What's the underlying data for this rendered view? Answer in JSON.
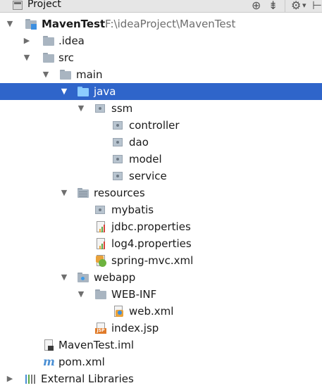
{
  "header": {
    "title": "Project",
    "locate_icon": "⊕",
    "collapse_icon": "⇟",
    "settings_icon": "⚙",
    "settings_arrow": "▾",
    "hide_icon": "⊢"
  },
  "tree": {
    "project_name": "MavenTest",
    "project_path": "F:\\ideaProject\\MavenTest",
    "idea": ".idea",
    "src": "src",
    "main": "main",
    "java": "java",
    "ssm": "ssm",
    "controller": "controller",
    "dao": "dao",
    "model": "model",
    "service": "service",
    "resources": "resources",
    "mybatis": "mybatis",
    "jdbc": "jdbc.properties",
    "log4j": "log4.properties",
    "spring_mvc": "spring-mvc.xml",
    "webapp": "webapp",
    "web_inf": "WEB-INF",
    "web_xml": "web.xml",
    "index_jsp": "index.jsp",
    "iml": "MavenTest.iml",
    "pom": "pom.xml",
    "external_libraries": "External Libraries",
    "jsp_badge": "JSP",
    "pom_badge": "m",
    "expanded_arrow": "▼",
    "collapsed_arrow": "▶"
  },
  "colors": {
    "selection": "#2f65ca",
    "folder": "#a9b5c1",
    "source_folder": "#4aa0ec"
  }
}
